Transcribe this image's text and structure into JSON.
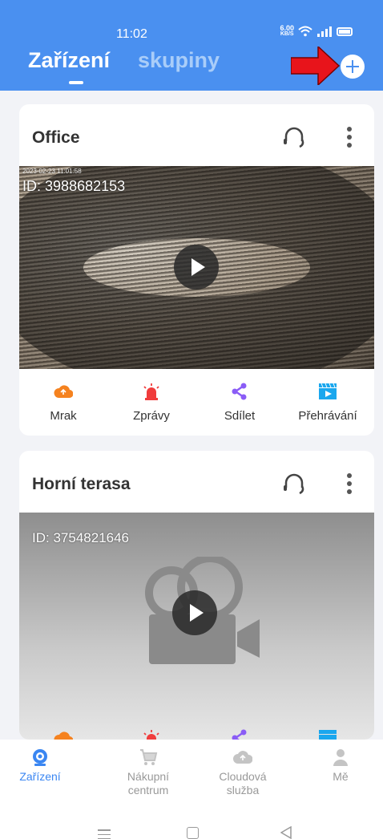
{
  "status_bar": {
    "time": "11:02",
    "speed_value": "6.00",
    "speed_unit": "KB/S"
  },
  "header": {
    "tabs": [
      {
        "label": "Zařízení",
        "active": true
      },
      {
        "label": "skupiny",
        "active": false
      }
    ],
    "add_icon": "plus-circle-icon",
    "annotation_arrow_color": "#e8141b"
  },
  "devices": [
    {
      "name": "Office",
      "id_label": "ID:",
      "id": "3988682153",
      "osd_timestamp": "2023-02-23 11:01:58",
      "actions": [
        {
          "label": "Mrak",
          "icon": "cloud-icon",
          "color": "#f5821f"
        },
        {
          "label": "Zprávy",
          "icon": "alarm-icon",
          "color": "#f03c3c"
        },
        {
          "label": "Sdílet",
          "icon": "share-icon",
          "color": "#8a5cf6"
        },
        {
          "label": "Přehrávání",
          "icon": "playback-icon",
          "color": "#1aa7ee"
        }
      ]
    },
    {
      "name": "Horní terasa",
      "id_label": "ID:",
      "id": "3754821646"
    }
  ],
  "bottom_nav": [
    {
      "label": "Zařízení",
      "icon": "camera-icon",
      "active": true
    },
    {
      "label": "Nákupní\ncentrum",
      "icon": "cart-icon",
      "active": false
    },
    {
      "label": "Cloudová\nslužba",
      "icon": "cloud-icon",
      "active": false
    },
    {
      "label": "Mě",
      "icon": "user-icon",
      "active": false
    }
  ],
  "colors": {
    "primary": "#4a90f0",
    "active_nav": "#3a86f2"
  }
}
